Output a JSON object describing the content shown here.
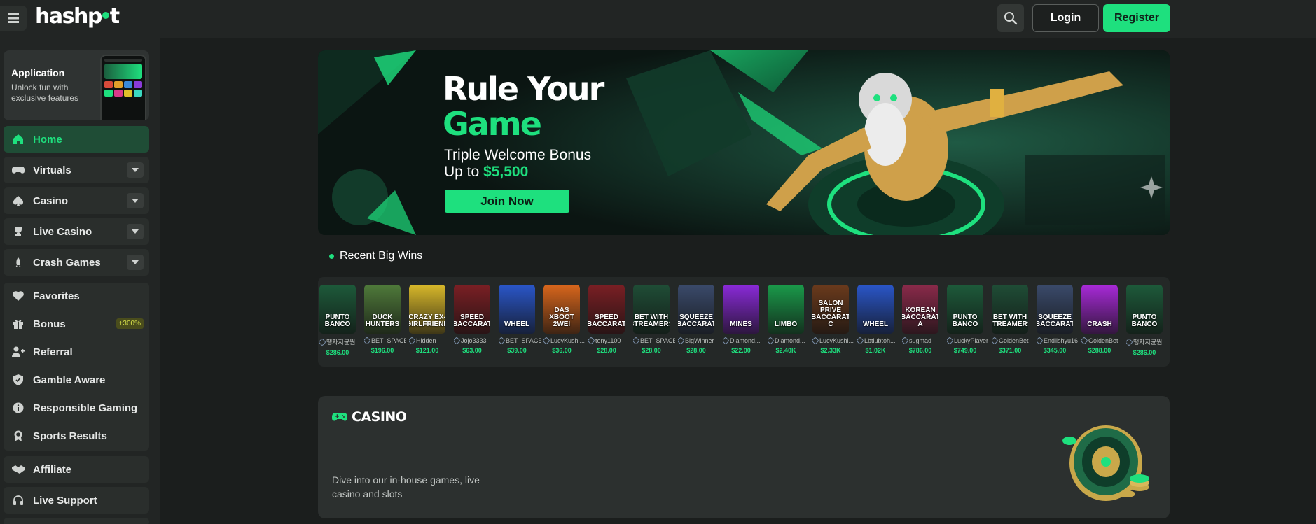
{
  "brand": {
    "logo_text_a": "hashp",
    "logo_text_b": "t"
  },
  "header": {
    "login_label": "Login",
    "register_label": "Register"
  },
  "sidebar": {
    "app_card": {
      "title": "Application",
      "subtitle": "Unlock fun with exclusive features"
    },
    "items": [
      {
        "label": "Home",
        "icon": "home-icon"
      },
      {
        "label": "Virtuals",
        "icon": "gamepad-icon"
      },
      {
        "label": "Casino",
        "icon": "spade-icon"
      },
      {
        "label": "Live Casino",
        "icon": "trophy-icon"
      },
      {
        "label": "Crash Games",
        "icon": "rocket-icon"
      },
      {
        "label": "Favorites",
        "icon": "heart-icon"
      },
      {
        "label": "Bonus",
        "icon": "gift-icon",
        "badge": "+300%"
      },
      {
        "label": "Referral",
        "icon": "user-plus-icon"
      },
      {
        "label": "Gamble Aware",
        "icon": "shield-icon"
      },
      {
        "label": "Responsible Gaming",
        "icon": "info-icon"
      },
      {
        "label": "Sports Results",
        "icon": "medal-icon"
      },
      {
        "label": "Affiliate",
        "icon": "handshake-icon"
      },
      {
        "label": "Live Support",
        "icon": "headset-icon"
      }
    ]
  },
  "banner": {
    "title_line1": "Rule Your",
    "title_line2": "Game",
    "subtitle_line1": "Triple Welcome Bonus",
    "subtitle_line2_prefix": "Up to ",
    "subtitle_amount": "$5,500",
    "cta_label": "Join Now"
  },
  "recent_wins": {
    "title": "Recent Big Wins",
    "items": [
      {
        "game": "PUNTO BANCO",
        "user": "땡자지균원",
        "amount": "$286.00",
        "color": "#1d5a3a"
      },
      {
        "game": "DUCK HUNTERS",
        "user": "BET_SPACE",
        "amount": "$196.00",
        "color": "#4f7a3a"
      },
      {
        "game": "CRAZY EX-GIRLFRIEND",
        "user": "Hidden",
        "amount": "$121.00",
        "color": "#d8b82a"
      },
      {
        "game": "SPEED BACCARAT",
        "user": "Jojo3333",
        "amount": "$63.00",
        "color": "#7a1f24"
      },
      {
        "game": "WHEEL",
        "user": "BET_SPACE",
        "amount": "$39.00",
        "color": "#2a56c8"
      },
      {
        "game": "DAS XBOOT 2WEI",
        "user": "LucyKushi...",
        "amount": "$36.00",
        "color": "#d8661c"
      },
      {
        "game": "SPEED BACCARAT",
        "user": "tony1100",
        "amount": "$28.00",
        "color": "#7a1f24"
      },
      {
        "game": "BET WITH STREAMERS",
        "user": "BET_SPACE",
        "amount": "$28.00",
        "color": "#1f4d36"
      },
      {
        "game": "SQUEEZE BACCARAT",
        "user": "BigWinner",
        "amount": "$28.00",
        "color": "#3a4a6a"
      },
      {
        "game": "MINES",
        "user": "Diamond...",
        "amount": "$22.00",
        "color": "#8a2ad8"
      },
      {
        "game": "LIMBO",
        "user": "Diamond...",
        "amount": "$2.40K",
        "color": "#1a9a4a"
      },
      {
        "game": "SALON PRIVE BACCARAT C",
        "user": "LucyKushi...",
        "amount": "$2.33K",
        "color": "#6a3a1c"
      },
      {
        "game": "WHEEL",
        "user": "Lbtiubtoh...",
        "amount": "$1.02K",
        "color": "#2a56c8"
      },
      {
        "game": "KOREAN BACCARAT A",
        "user": "sugmad",
        "amount": "$786.00",
        "color": "#8a2a4a"
      },
      {
        "game": "PUNTO BANCO",
        "user": "LuckyPlayer",
        "amount": "$749.00",
        "color": "#1d5a3a"
      },
      {
        "game": "BET WITH STREAMERS",
        "user": "GoldenBet",
        "amount": "$371.00",
        "color": "#1f4d36"
      },
      {
        "game": "SQUEEZE BACCARAT",
        "user": "Endlishyu16",
        "amount": "$345.00",
        "color": "#3a4a6a"
      },
      {
        "game": "CRASH",
        "user": "GoldenBet",
        "amount": "$288.00",
        "color": "#a82ad8"
      },
      {
        "game": "PUNTO BANCO",
        "user": "땡자지균원",
        "amount": "$286.00",
        "color": "#1d5a3a"
      }
    ]
  },
  "casino_section": {
    "title": "CASINO",
    "description": "Dive into our in-house games, live casino and slots"
  },
  "colors": {
    "accent": "#1ee07e",
    "background": "#1b1e1d",
    "panel": "#2c302f"
  }
}
